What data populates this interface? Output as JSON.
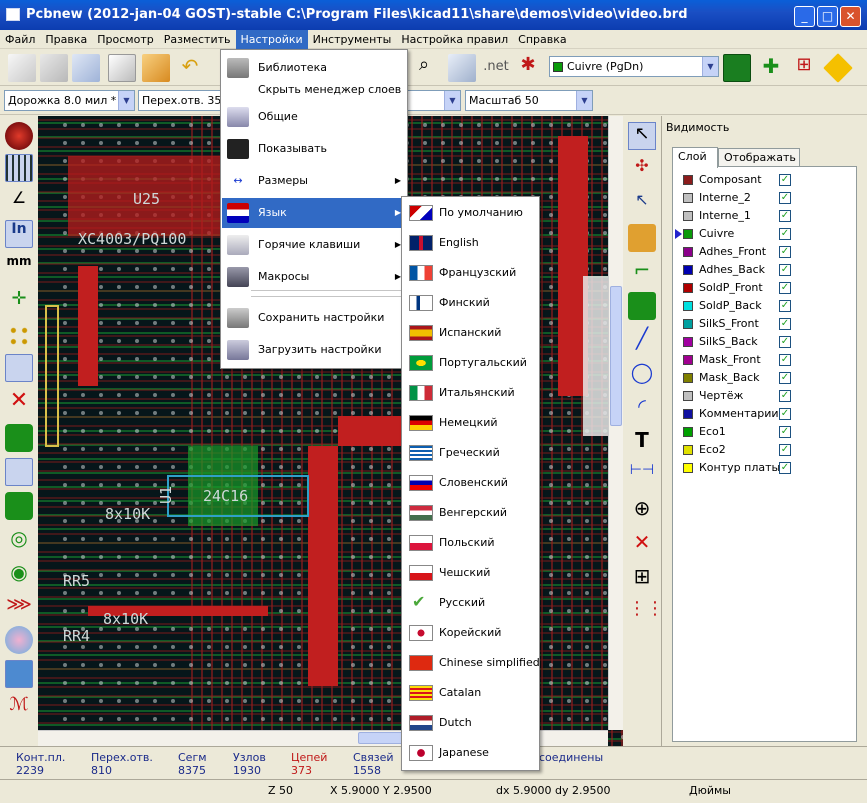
{
  "window": {
    "title": "Pcbnew (2012-jan-04 GOST)-stable C:\\Program Files\\kicad11\\share\\demos\\video\\video.brd"
  },
  "menubar": [
    "Файл",
    "Правка",
    "Просмотр",
    "Разместить",
    "Настройки",
    "Инструменты",
    "Настройка правил",
    "Справка"
  ],
  "toolbar": {
    "layer_select": "Cuivre (PgDn)"
  },
  "toolbar2": {
    "track": "Дорожка 8.0 мил *",
    "via": "Перех.отв. 35.0",
    "zoom": "Масштаб 50"
  },
  "settings_menu": {
    "items": [
      {
        "label": "Библиотека",
        "icon": "book-icon",
        "submenu": false
      },
      {
        "label": "Скрыть менеджер слоев",
        "icon": "",
        "submenu": false
      },
      {
        "label": "Общие",
        "icon": "tools-icon",
        "submenu": false
      },
      {
        "label": "Показывать",
        "icon": "display-icon",
        "submenu": false
      },
      {
        "label": "Размеры",
        "icon": "dimension-icon",
        "submenu": true
      },
      {
        "label": "Язык",
        "icon": "language-flags-icon",
        "submenu": true
      },
      {
        "label": "Горячие клавиши",
        "icon": "hotkeys-icon",
        "submenu": true
      },
      {
        "label": "Макросы",
        "icon": "macros-icon",
        "submenu": true
      },
      {
        "label": "Сохранить настройки",
        "icon": "save-settings-icon",
        "submenu": false
      },
      {
        "label": "Загрузить настройки",
        "icon": "load-settings-icon",
        "submenu": false
      }
    ]
  },
  "language_menu": {
    "items": [
      "По умолчанию",
      "English",
      "Французский",
      "Финский",
      "Испанский",
      "Португальский",
      "Итальянский",
      "Немецкий",
      "Греческий",
      "Словенский",
      "Венгерский",
      "Польский",
      "Чешский",
      "Русский",
      "Корейский",
      "Chinese simplified",
      "Catalan",
      "Dutch",
      "Japanese"
    ],
    "checked": "Русский"
  },
  "panel": {
    "title": "Видимость",
    "tabs": [
      "Слой",
      "Отображать"
    ],
    "current_layer": "Cuivre",
    "layers": [
      {
        "name": "Composant",
        "color": "#8b1c1c"
      },
      {
        "name": "Interne_2",
        "color": "#c0c0c0"
      },
      {
        "name": "Interne_1",
        "color": "#c0c0c0"
      },
      {
        "name": "Cuivre",
        "color": "#0a9a0a"
      },
      {
        "name": "Adhes_Front",
        "color": "#8b008b"
      },
      {
        "name": "Adhes_Back",
        "color": "#0000b0"
      },
      {
        "name": "SoldP_Front",
        "color": "#b00000"
      },
      {
        "name": "SoldP_Back",
        "color": "#00e0e0"
      },
      {
        "name": "SilkS_Front",
        "color": "#00a0a0"
      },
      {
        "name": "SilkS_Back",
        "color": "#a000a0"
      },
      {
        "name": "Mask_Front",
        "color": "#a00090"
      },
      {
        "name": "Mask_Back",
        "color": "#808000"
      },
      {
        "name": "Чертёж",
        "color": "#c0c0c0"
      },
      {
        "name": "Комментарии",
        "color": "#1010a0"
      },
      {
        "name": "Eco1",
        "color": "#00a000"
      },
      {
        "name": "Eco2",
        "color": "#e0e000"
      },
      {
        "name": "Контур платы",
        "color": "#ffff00"
      }
    ]
  },
  "status": {
    "labels": [
      "Конт.пл.",
      "Перех.отв.",
      "Сегм",
      "Узлов",
      "Цепей",
      "Связей"
    ],
    "values": [
      "2239",
      "810",
      "8375",
      "1930",
      "373",
      "1558"
    ],
    "hidden_value": "1558",
    "connected_suffix": "соединены",
    "zoom": "Z 50",
    "xy": "X 5.9000  Y 2.9500",
    "dxdy": "dx 5.9000  dy 2.9500",
    "units": "Дюймы"
  },
  "canvas": {
    "labels": [
      "U25",
      "XC4003/PQ100",
      "8x10K",
      "U1",
      "24C16",
      "8x10K",
      "RR5",
      "RR4",
      "8x10K"
    ],
    "colors": {
      "background": "#06161a",
      "copper_red": "#c11f1f",
      "copper_green": "#1a9b2a",
      "silk": "#cfd8d8",
      "via_yellow": "#d8c04a"
    }
  }
}
